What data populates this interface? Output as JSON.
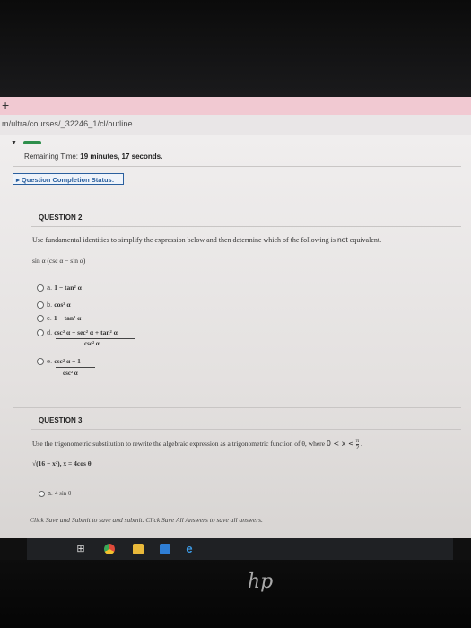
{
  "browser": {
    "new_tab_symbol": "+",
    "url": "m/ultra/courses/_32246_1/cl/outline"
  },
  "test": {
    "collapse_icon": "triangle-down-icon",
    "timer_label": "Remaining Time:",
    "timer_value": "19 minutes, 17 seconds.",
    "status_button": "Question Completion Status:"
  },
  "question2": {
    "title": "QUESTION 2",
    "instruction_pre": "Use fundamental identities to simplify the expression below and then determine which of the following is",
    "instruction_not": "not",
    "instruction_post": "equivalent.",
    "expression": "sin α (csc α − sin α)",
    "options": [
      {
        "label": "a.",
        "text": "1 − tan² α"
      },
      {
        "label": "b.",
        "text": "cos² α"
      },
      {
        "label": "c.",
        "text": "1 − tan² α"
      },
      {
        "label": "d.",
        "numerator": "csc² α − sec² α + tan² α",
        "denominator": "csc² α"
      },
      {
        "label": "e.",
        "numerator": "csc² α − 1",
        "denominator": "csc² α"
      }
    ]
  },
  "question3": {
    "title": "QUESTION 3",
    "instruction": "Use the trigonometric substitution to rewrite the algebraic expression as a trigonometric function of θ, where",
    "condition_pre": "0 < x <",
    "condition_num": "π",
    "condition_den": "2",
    "condition_post": ".",
    "substitution": "√(16 − x²), x = 4cos θ",
    "first_option": {
      "label": "a.",
      "text": "4 sin θ"
    }
  },
  "footer_hint": "Click Save and Submit to save and submit. Click Save All Answers to save all answers.",
  "taskbar": {
    "icons": [
      "task-view-icon",
      "chrome-icon",
      "file-explorer-icon",
      "store-icon",
      "edge-icon"
    ]
  },
  "colors": {
    "accent_blue": "#2a5f9e",
    "progress_green": "#2e8f4c",
    "browser_tab_pink": "#f1c9d2"
  }
}
